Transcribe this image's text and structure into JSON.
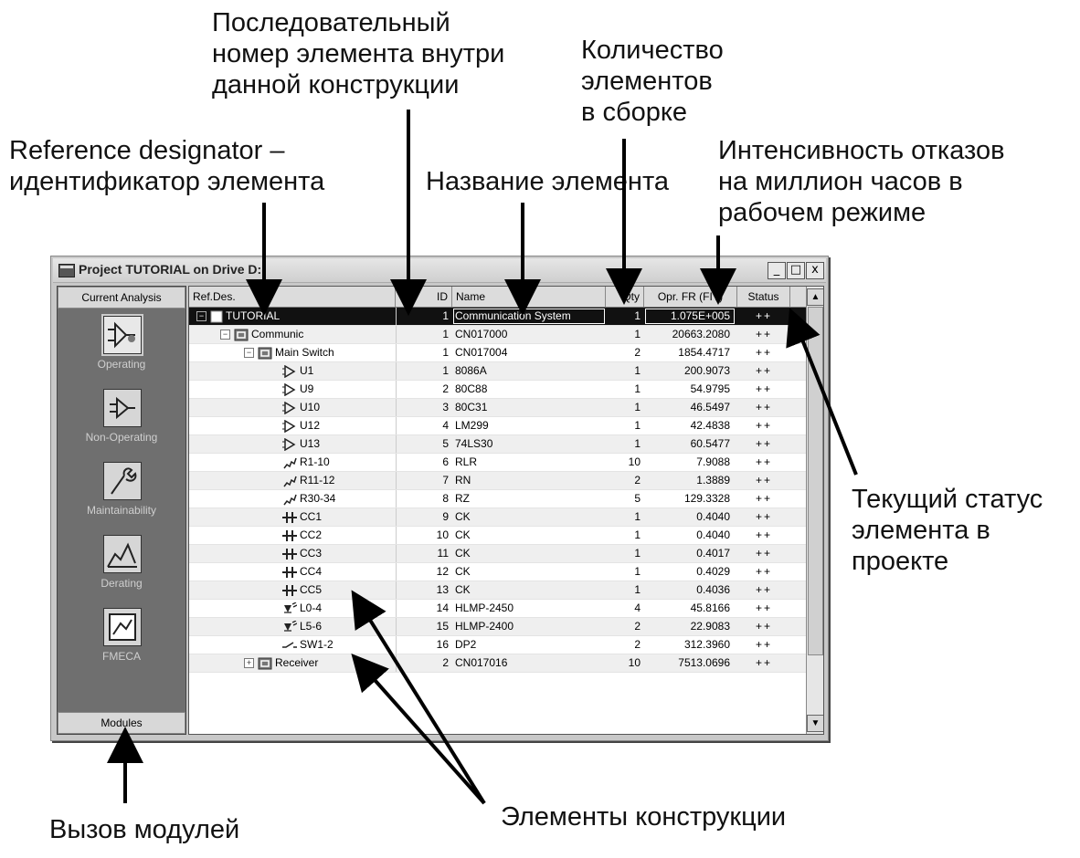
{
  "annotations": {
    "sequence_number": [
      "Последовательный",
      "номер элемента внутри",
      "данной конструкции"
    ],
    "quantity": [
      "Количество",
      "элементов",
      "в сборке"
    ],
    "ref_designator": [
      "Reference designator –",
      "идентификатор элемента"
    ],
    "element_name": [
      "Название элемента"
    ],
    "failure_rate": [
      "Интенсивность отказов",
      "на миллион часов в",
      "рабочем режиме"
    ],
    "status": [
      "Текущий статус",
      "элемента в",
      "проекте"
    ],
    "modules_call": [
      "Вызов модулей"
    ],
    "design_elements": [
      "Элементы конструкции"
    ]
  },
  "window": {
    "title": "Project TUTORIAL on Drive D:",
    "min_label": "_",
    "max_label": "□",
    "close_label": "x"
  },
  "sidebar": {
    "header": "Current Analysis",
    "footer": "Modules",
    "modules": [
      {
        "label": "Operating",
        "icon": "operating-icon"
      },
      {
        "label": "Non-Operating",
        "icon": "non-operating-icon"
      },
      {
        "label": "Maintainability",
        "icon": "maintainability-icon"
      },
      {
        "label": "Derating",
        "icon": "derating-icon"
      },
      {
        "label": "FMECA",
        "icon": "fmeca-icon"
      }
    ]
  },
  "table": {
    "columns": {
      "ref": "Ref.Des.",
      "id": "ID",
      "name": "Name",
      "qty": "Qty",
      "fr": "Opr. FR (FIT)",
      "status": "Status"
    },
    "rows": [
      {
        "ref": "TUTORIAL",
        "id": "1",
        "name": "Communication System",
        "qty": "1",
        "fr": "1.075E+005",
        "status": "++",
        "level": 0,
        "kind": "root",
        "pm": "⊟"
      },
      {
        "ref": "Communic",
        "id": "1",
        "name": "CN017000",
        "qty": "1",
        "fr": "20663.2080",
        "status": "++",
        "level": 1,
        "kind": "assembly",
        "pm": "⊟"
      },
      {
        "ref": "Main Switch",
        "id": "1",
        "name": "CN017004",
        "qty": "2",
        "fr": "1854.4717",
        "status": "++",
        "level": 2,
        "kind": "assembly",
        "pm": "⊟"
      },
      {
        "ref": "U1",
        "id": "1",
        "name": "8086A",
        "qty": "1",
        "fr": "200.9073",
        "status": "++",
        "level": 3,
        "kind": "ic"
      },
      {
        "ref": "U9",
        "id": "2",
        "name": "80C88",
        "qty": "1",
        "fr": "54.9795",
        "status": "++",
        "level": 3,
        "kind": "ic"
      },
      {
        "ref": "U10",
        "id": "3",
        "name": "80C31",
        "qty": "1",
        "fr": "46.5497",
        "status": "++",
        "level": 3,
        "kind": "ic"
      },
      {
        "ref": "U12",
        "id": "4",
        "name": "LM299",
        "qty": "1",
        "fr": "42.4838",
        "status": "++",
        "level": 3,
        "kind": "ic"
      },
      {
        "ref": "U13",
        "id": "5",
        "name": "74LS30",
        "qty": "1",
        "fr": "60.5477",
        "status": "++",
        "level": 3,
        "kind": "ic"
      },
      {
        "ref": "R1-10",
        "id": "6",
        "name": "RLR",
        "qty": "10",
        "fr": "7.9088",
        "status": "++",
        "level": 3,
        "kind": "resistor"
      },
      {
        "ref": "R11-12",
        "id": "7",
        "name": "RN",
        "qty": "2",
        "fr": "1.3889",
        "status": "++",
        "level": 3,
        "kind": "resistor"
      },
      {
        "ref": "R30-34",
        "id": "8",
        "name": "RZ",
        "qty": "5",
        "fr": "129.3328",
        "status": "++",
        "level": 3,
        "kind": "resistor"
      },
      {
        "ref": "CC1",
        "id": "9",
        "name": "CK",
        "qty": "1",
        "fr": "0.4040",
        "status": "++",
        "level": 3,
        "kind": "capacitor"
      },
      {
        "ref": "CC2",
        "id": "10",
        "name": "CK",
        "qty": "1",
        "fr": "0.4040",
        "status": "++",
        "level": 3,
        "kind": "capacitor"
      },
      {
        "ref": "CC3",
        "id": "11",
        "name": "CK",
        "qty": "1",
        "fr": "0.4017",
        "status": "++",
        "level": 3,
        "kind": "capacitor"
      },
      {
        "ref": "CC4",
        "id": "12",
        "name": "CK",
        "qty": "1",
        "fr": "0.4029",
        "status": "++",
        "level": 3,
        "kind": "capacitor"
      },
      {
        "ref": "CC5",
        "id": "13",
        "name": "CK",
        "qty": "1",
        "fr": "0.4036",
        "status": "++",
        "level": 3,
        "kind": "capacitor"
      },
      {
        "ref": "L0-4",
        "id": "14",
        "name": "HLMP-2450",
        "qty": "4",
        "fr": "45.8166",
        "status": "++",
        "level": 3,
        "kind": "led"
      },
      {
        "ref": "L5-6",
        "id": "15",
        "name": "HLMP-2400",
        "qty": "2",
        "fr": "22.9083",
        "status": "++",
        "level": 3,
        "kind": "led"
      },
      {
        "ref": "SW1-2",
        "id": "16",
        "name": "DP2",
        "qty": "2",
        "fr": "312.3960",
        "status": "++",
        "level": 3,
        "kind": "switch"
      },
      {
        "ref": "Receiver",
        "id": "2",
        "name": "CN017016",
        "qty": "10",
        "fr": "7513.0696",
        "status": "++",
        "level": 2,
        "kind": "assembly",
        "pm": "⊞"
      }
    ]
  }
}
